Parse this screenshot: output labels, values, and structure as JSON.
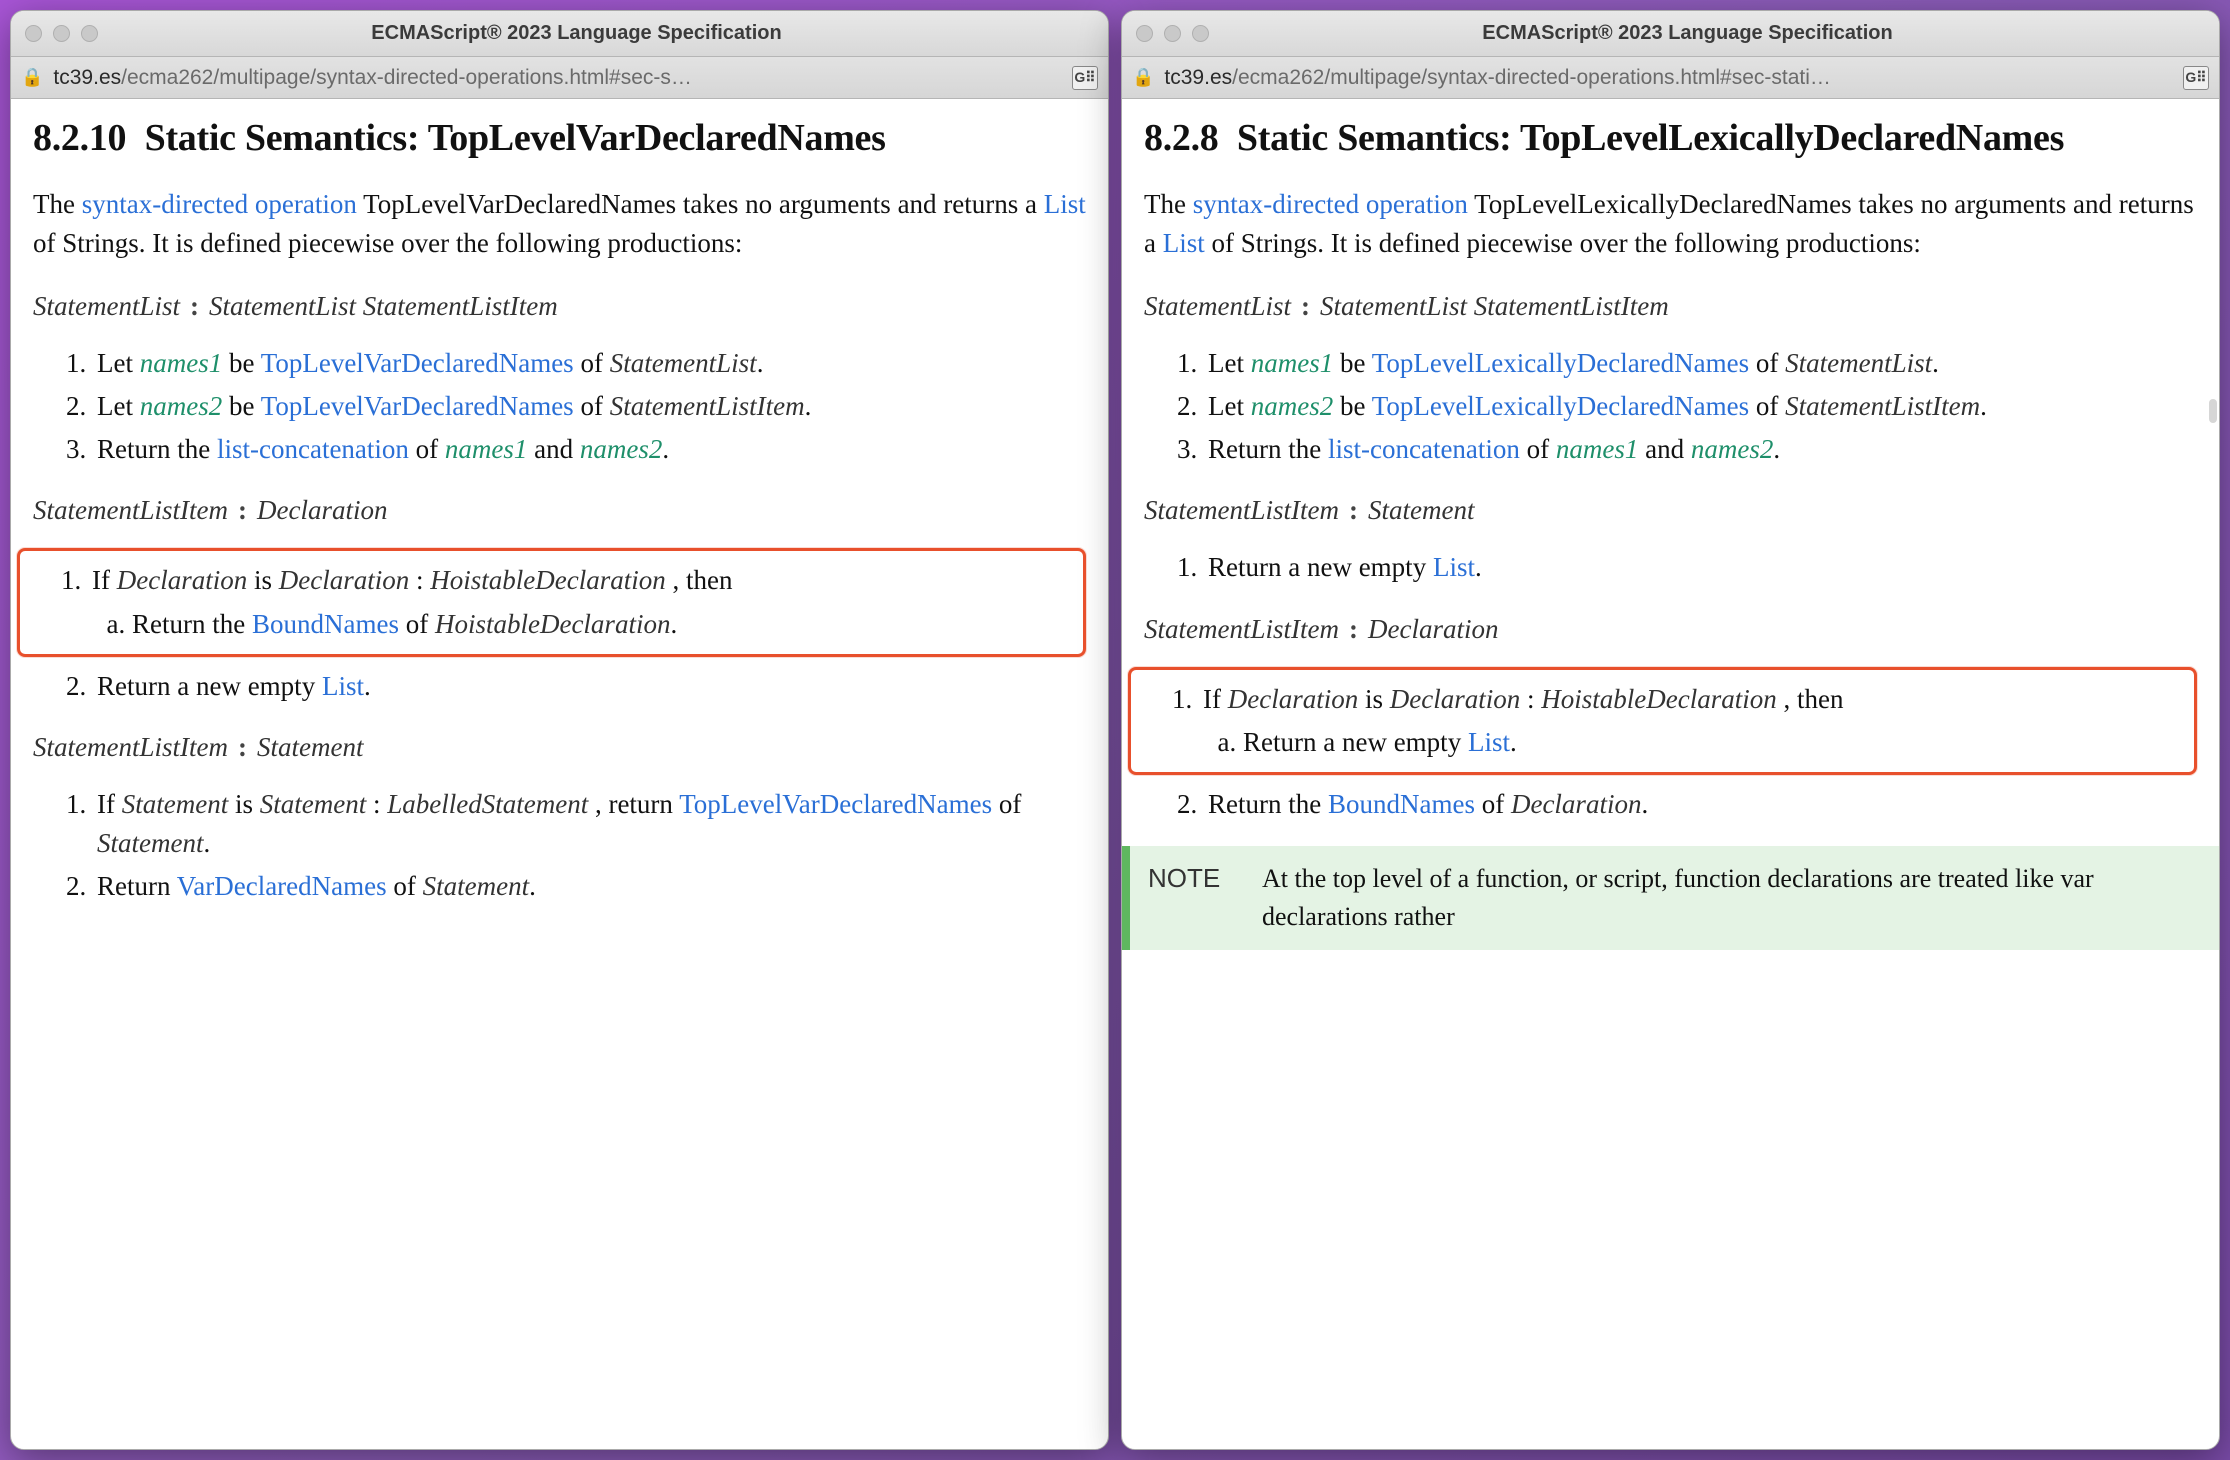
{
  "left": {
    "window_title": "ECMAScript® 2023 Language Specification",
    "url_domain": "tc39.es",
    "url_path": "/ecma262/multipage/syntax-directed-operations.html#sec-s…",
    "heading_num": "8.2.10",
    "heading_text": "Static Semantics: TopLevelVarDeclaredNames",
    "intro_pre": "The ",
    "intro_sdo": "syntax-directed operation",
    "intro_name": " TopLevelVarDeclaredNames takes no arguments and returns a ",
    "intro_list": "List",
    "intro_post": " of Strings. It is defined piecewise over the following productions:",
    "g1_lhs": "StatementList",
    "g1_rhs": "StatementList  StatementListItem",
    "a1_1_pre": "Let ",
    "a1_1_v": "names1",
    "a1_1_mid": " be ",
    "a1_1_op": "TopLevelVarDeclaredNames",
    "a1_1_of": " of ",
    "a1_1_nt": "StatementList",
    "a1_1_end": ".",
    "a1_2_pre": "Let ",
    "a1_2_v": "names2",
    "a1_2_mid": " be ",
    "a1_2_op": "TopLevelVarDeclaredNames",
    "a1_2_of": " of ",
    "a1_2_nt": "StatementListItem",
    "a1_2_end": ".",
    "a1_3_pre": "Return the ",
    "a1_3_op": "list-concatenation",
    "a1_3_of": " of ",
    "a1_3_v1": "names1",
    "a1_3_and": " and ",
    "a1_3_v2": "names2",
    "a1_3_end": ".",
    "g2_lhs": "StatementListItem",
    "g2_rhs": "Declaration",
    "hl_1_pre": "If ",
    "hl_1_nt1": "Declaration",
    "hl_1_is": " is  ",
    "hl_1_nt2": "Declaration",
    "hl_1_colon": " : ",
    "hl_1_nt3": "HoistableDeclaration",
    "hl_1_then": " , then",
    "hl_1a_pre": "Return the ",
    "hl_1a_op": "BoundNames",
    "hl_1a_of": " of ",
    "hl_1a_nt": "HoistableDeclaration",
    "hl_1a_end": ".",
    "a2_2_pre": "Return a new empty ",
    "a2_2_list": "List",
    "a2_2_end": ".",
    "g3_lhs": "StatementListItem",
    "g3_rhs": "Statement",
    "a3_1_pre": "If ",
    "a3_1_nt1": "Statement",
    "a3_1_is": " is  ",
    "a3_1_nt2": "Statement",
    "a3_1_colon": " : ",
    "a3_1_nt3": "LabelledStatement",
    "a3_1_ret": " , return ",
    "a3_1_op": "TopLevelVarDeclaredNames",
    "a3_1_of": " of ",
    "a3_1_nt4": "Statement",
    "a3_1_end": ".",
    "a3_2_pre": "Return ",
    "a3_2_op": "VarDeclaredNames",
    "a3_2_of": " of ",
    "a3_2_nt": "Statement",
    "a3_2_end": "."
  },
  "right": {
    "window_title": "ECMAScript® 2023 Language Specification",
    "url_domain": "tc39.es",
    "url_path": "/ecma262/multipage/syntax-directed-operations.html#sec-stati…",
    "heading_num": "8.2.8",
    "heading_text": "Static Semantics: TopLevelLexicallyDeclaredNames",
    "intro_pre": "The ",
    "intro_sdo": "syntax-directed operation",
    "intro_name": " TopLevelLexicallyDeclaredNames takes no arguments and returns a ",
    "intro_list": "List",
    "intro_post": " of Strings. It is defined piecewise over the following productions:",
    "g1_lhs": "StatementList",
    "g1_rhs": "StatementList  StatementListItem",
    "a1_1_pre": "Let ",
    "a1_1_v": "names1",
    "a1_1_mid": " be ",
    "a1_1_op": "TopLevelLexicallyDeclaredNames",
    "a1_1_of": " of ",
    "a1_1_nt": "StatementList",
    "a1_1_end": ".",
    "a1_2_pre": "Let ",
    "a1_2_v": "names2",
    "a1_2_mid": " be ",
    "a1_2_op": "TopLevelLexicallyDeclaredNames",
    "a1_2_of": " of ",
    "a1_2_nt": "StatementListItem",
    "a1_2_end": ".",
    "a1_3_pre": "Return the ",
    "a1_3_op": "list-concatenation",
    "a1_3_of": " of ",
    "a1_3_v1": "names1",
    "a1_3_and": " and ",
    "a1_3_v2": "names2",
    "a1_3_end": ".",
    "g2_lhs": "StatementListItem",
    "g2_rhs": "Statement",
    "a2_1_pre": "Return a new empty ",
    "a2_1_list": "List",
    "a2_1_end": ".",
    "g3_lhs": "StatementListItem",
    "g3_rhs": "Declaration",
    "hl_1_pre": "If ",
    "hl_1_nt1": "Declaration",
    "hl_1_is": " is  ",
    "hl_1_nt2": "Declaration",
    "hl_1_colon": " : ",
    "hl_1_nt3": "HoistableDeclaration",
    "hl_1_then": " , then",
    "hl_1a_pre": "Return a new empty ",
    "hl_1a_list": "List",
    "hl_1a_end": ".",
    "a3_2_pre": "Return the ",
    "a3_2_op": "BoundNames",
    "a3_2_of": " of ",
    "a3_2_nt": "Declaration",
    "a3_2_end": ".",
    "note_label": "NOTE",
    "note_body": "At the top level of a function, or script, function declarations are treated like var declarations rather"
  },
  "icons": {
    "translate": "G⠿"
  }
}
